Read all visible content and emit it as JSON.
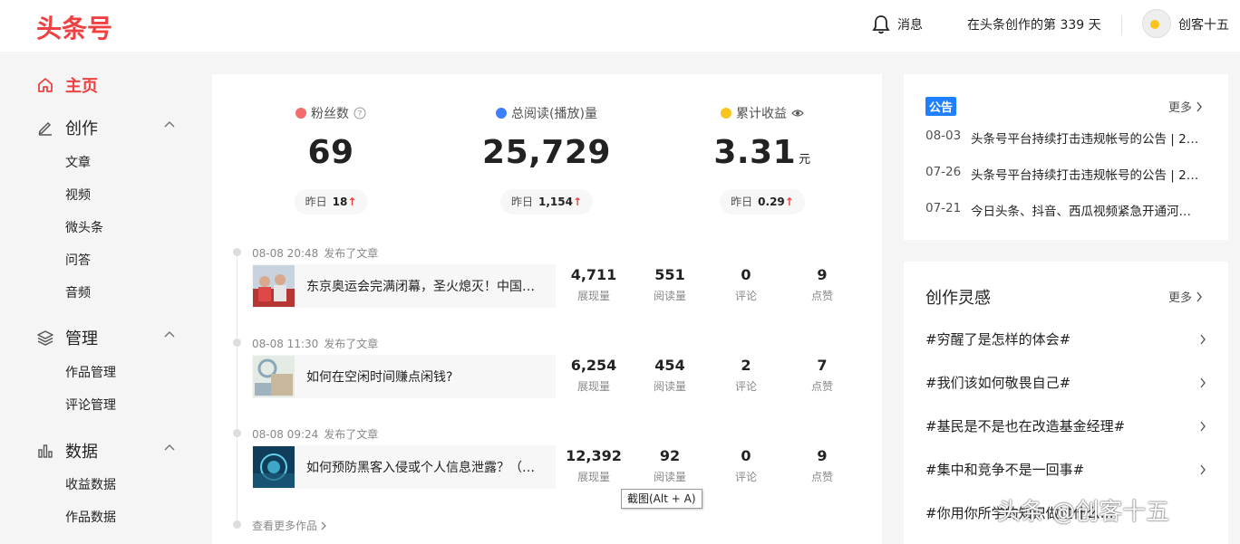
{
  "header": {
    "logo": "头条号",
    "messages_label": "消息",
    "days_text": "在头条创作的第 339 天",
    "username": "创客十五"
  },
  "sidebar": {
    "home": "主页",
    "groups": [
      {
        "label": "创作",
        "items": [
          "文章",
          "视频",
          "微头条",
          "问答",
          "音频"
        ]
      },
      {
        "label": "管理",
        "items": [
          "作品管理",
          "评论管理"
        ]
      },
      {
        "label": "数据",
        "items": [
          "收益数据",
          "作品数据"
        ]
      }
    ]
  },
  "stats": [
    {
      "label": "粉丝数",
      "value": "69",
      "unit": "",
      "yesterday_label": "昨日",
      "yesterday_value": "18",
      "trend": "↑",
      "icon": "fans-icon",
      "color": "#f56c6c"
    },
    {
      "label": "总阅读(播放)量",
      "value": "25,729",
      "unit": "",
      "yesterday_label": "昨日",
      "yesterday_value": "1,154",
      "trend": "↑",
      "icon": "reads-icon",
      "color": "#3d7eff"
    },
    {
      "label": "累计收益",
      "value": "3.31",
      "unit": "元",
      "yesterday_label": "昨日",
      "yesterday_value": "0.29",
      "trend": "↑",
      "icon": "coin-icon",
      "color": "#f8c51c"
    }
  ],
  "timeline": {
    "items": [
      {
        "time": "08-08 20:48",
        "action": "发布了文章",
        "title": "东京奥运会完满闭幕，圣火熄灭！中国…",
        "impressions": "4,711",
        "reads": "551",
        "comments": "0",
        "likes": "9"
      },
      {
        "time": "08-08 11:30",
        "action": "发布了文章",
        "title": "如何在空闲时间赚点闲钱?",
        "impressions": "6,254",
        "reads": "454",
        "comments": "2",
        "likes": "7"
      },
      {
        "time": "08-08 09:24",
        "action": "发布了文章",
        "title": "如何预防黑客入侵或个人信息泄露？（…",
        "impressions": "12,392",
        "reads": "92",
        "comments": "0",
        "likes": "9"
      }
    ],
    "metric_labels": {
      "impressions": "展现量",
      "reads": "阅读量",
      "comments": "评论",
      "likes": "点赞"
    },
    "more": "查看更多作品"
  },
  "tooltip": "截图(Alt + A)",
  "notice": {
    "badge": "公告",
    "more": "更多",
    "items": [
      {
        "date": "08-03",
        "text": "头条号平台持续打击违规帐号的公告 | 2…"
      },
      {
        "date": "07-26",
        "text": "头条号平台持续打击违规帐号的公告 | 2…"
      },
      {
        "date": "07-21",
        "text": "今日头条、抖音、西瓜视频紧急开通河…"
      }
    ]
  },
  "inspiration": {
    "title": "创作灵感",
    "more": "更多",
    "topics": [
      "#穷醒了是怎样的体会#",
      "#我们该如何敬畏自己#",
      "#基民是不是也在改造基金经理#",
      "#集中和竞争不是一回事#",
      "#你用你所学的知识做过什么…"
    ]
  },
  "watermark": "头条 @创客十五"
}
